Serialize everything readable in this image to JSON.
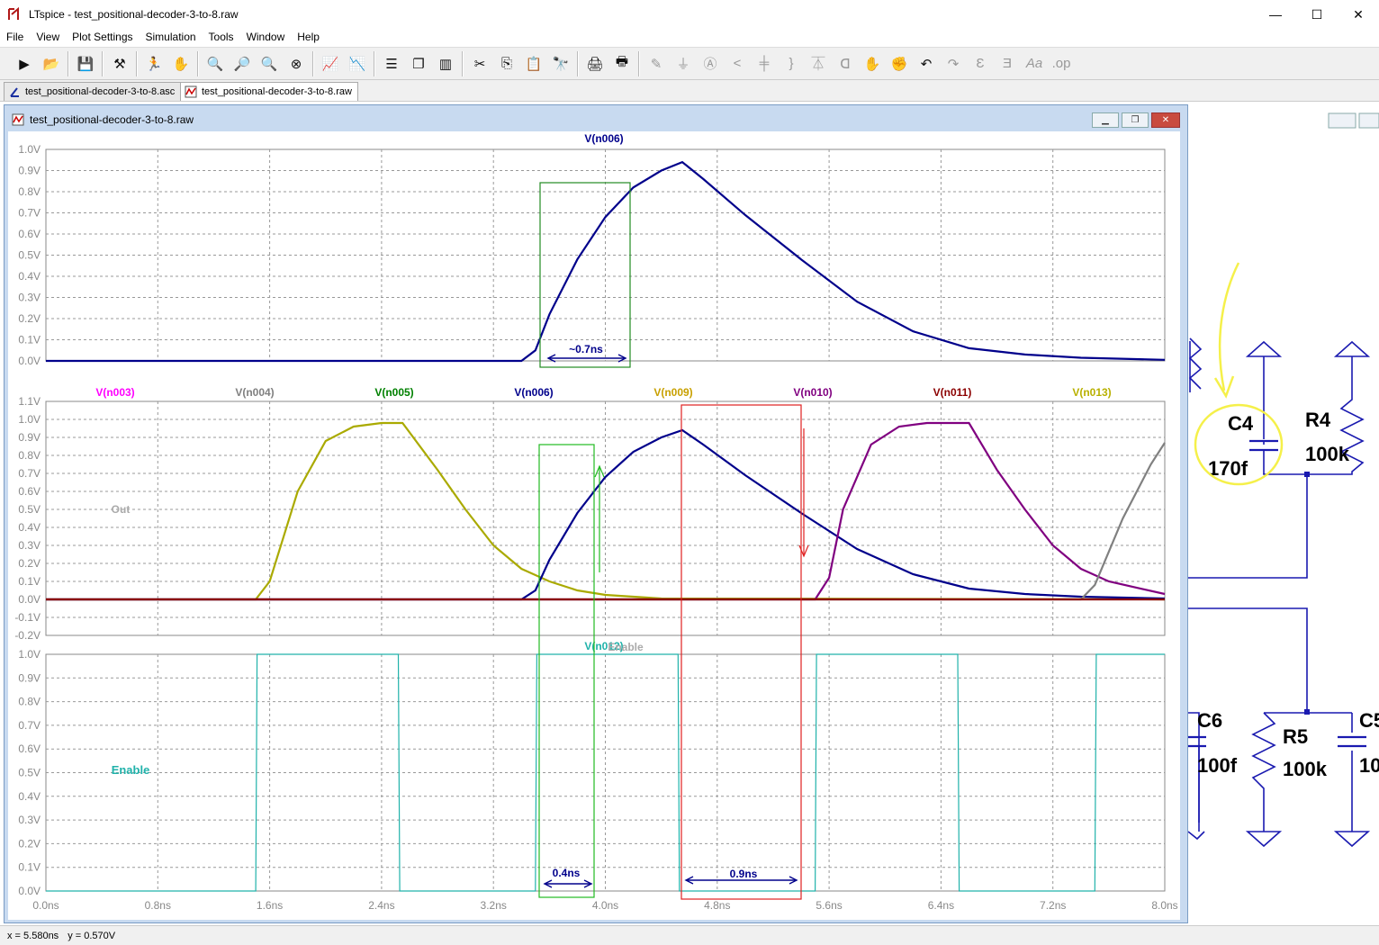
{
  "window": {
    "title": "LTspice - test_positional-decoder-3-to-8.raw",
    "minimize": "—",
    "maximize": "☐",
    "close": "✕"
  },
  "menu": [
    "File",
    "View",
    "Plot Settings",
    "Simulation",
    "Tools",
    "Window",
    "Help"
  ],
  "toolbar": {
    "icons": [
      "run-icon",
      "open-icon",
      "save-icon",
      "control-panel-icon",
      "halt-icon",
      "pan-icon",
      "zoom-in-icon",
      "zoom-area-icon",
      "zoom-out-icon",
      "zoom-fit-icon",
      "autorange-icon",
      "manual-limits-icon",
      "tile-horizontal-icon",
      "cascade-icon",
      "tile-vertical-icon",
      "cut-icon",
      "copy-icon",
      "paste-icon",
      "find-icon",
      "print-icon",
      "print-preview-icon",
      "wire-icon",
      "ground-icon",
      "label-icon",
      "resistor-icon",
      "capacitor-icon",
      "inductor-icon",
      "diode-icon",
      "component-icon",
      "move-icon",
      "drag-icon",
      "undo-icon",
      "redo-icon",
      "rotate-icon",
      "mirror-icon",
      "text-icon",
      "spice-directive-icon"
    ]
  },
  "tabs": [
    {
      "label": "test_positional-decoder-3-to-8.asc",
      "active": false
    },
    {
      "label": "test_positional-decoder-3-to-8.raw",
      "active": true
    }
  ],
  "plot_window": {
    "title": "test_positional-decoder-3-to-8.raw"
  },
  "statusbar": {
    "x": "x = 5.580ns",
    "y": "y = 0.570V"
  },
  "chart_data": [
    {
      "type": "line",
      "pane": "top",
      "series": [
        {
          "name": "V(n006)",
          "color": "#00008b",
          "x": [
            0,
            3.3,
            3.4,
            3.5,
            3.6,
            3.8,
            4.0,
            4.2,
            4.4,
            4.55,
            4.7,
            5.0,
            5.4,
            5.8,
            6.2,
            6.6,
            7.0,
            7.4,
            8.0
          ],
          "y": [
            0,
            0,
            0,
            0.05,
            0.22,
            0.48,
            0.68,
            0.82,
            0.9,
            0.94,
            0.86,
            0.69,
            0.48,
            0.28,
            0.14,
            0.06,
            0.03,
            0.015,
            0.005
          ]
        }
      ],
      "ylim": [
        0,
        1.0
      ],
      "yticks": [
        "1.0V",
        "0.9V",
        "0.8V",
        "0.7V",
        "0.6V",
        "0.5V",
        "0.4V",
        "0.3V",
        "0.2V",
        "0.1V",
        "0.0V"
      ],
      "annotations": [
        "~0.7ns"
      ]
    },
    {
      "type": "line",
      "pane": "middle",
      "legend": [
        "V(n003)",
        "V(n004)",
        "V(n005)",
        "V(n006)",
        "V(n009)",
        "V(n010)",
        "V(n011)",
        "V(n013)"
      ],
      "legend_colors": [
        "#ff00ff",
        "#808080",
        "#008000",
        "#00008b",
        "#c8a000",
        "#800080",
        "#8b0000",
        "#b8b000"
      ],
      "series": [
        {
          "name": "V(n005)",
          "color": "#aaaa00",
          "x": [
            0,
            1.5,
            1.6,
            1.8,
            2.0,
            2.2,
            2.4,
            2.55,
            2.8,
            3.0,
            3.2,
            3.4,
            3.6,
            3.8,
            4.0,
            4.4,
            8.0
          ],
          "y": [
            0,
            0,
            0.1,
            0.6,
            0.88,
            0.96,
            0.98,
            0.98,
            0.72,
            0.5,
            0.3,
            0.17,
            0.1,
            0.05,
            0.025,
            0.005,
            0
          ]
        },
        {
          "name": "V(n006)",
          "color": "#00008b",
          "x": [
            0,
            3.3,
            3.4,
            3.5,
            3.6,
            3.8,
            4.0,
            4.2,
            4.4,
            4.55,
            4.7,
            5.0,
            5.4,
            5.8,
            6.2,
            6.6,
            7.0,
            7.4,
            8.0
          ],
          "y": [
            0,
            0,
            0,
            0.05,
            0.22,
            0.48,
            0.68,
            0.82,
            0.9,
            0.94,
            0.86,
            0.69,
            0.48,
            0.28,
            0.14,
            0.06,
            0.03,
            0.015,
            0.005
          ]
        },
        {
          "name": "V(n011)",
          "color": "#800080",
          "x": [
            0,
            5.5,
            5.6,
            5.7,
            5.9,
            6.1,
            6.3,
            6.5,
            6.6,
            6.8,
            7.0,
            7.2,
            7.4,
            7.6,
            8.0
          ],
          "y": [
            0,
            0,
            0.12,
            0.5,
            0.86,
            0.96,
            0.98,
            0.98,
            0.98,
            0.72,
            0.5,
            0.3,
            0.17,
            0.1,
            0.03
          ]
        },
        {
          "name": "V(n013)",
          "color": "#808080",
          "x": [
            0,
            7.4,
            7.5,
            7.7,
            7.9,
            8.0
          ],
          "y": [
            0,
            0,
            0.08,
            0.45,
            0.75,
            0.87
          ]
        },
        {
          "name": "V(n004)",
          "color": "#8b0000",
          "x": [
            0,
            8.0
          ],
          "y": [
            0,
            0
          ]
        }
      ],
      "ylim": [
        -0.2,
        1.1
      ],
      "yticks": [
        "1.1V",
        "1.0V",
        "0.9V",
        "0.8V",
        "0.7V",
        "0.6V",
        "0.5V",
        "0.4V",
        "0.3V",
        "0.2V",
        "0.1V",
        "0.0V",
        "-0.1V",
        "-0.2V"
      ],
      "annotations": [
        "Out"
      ]
    },
    {
      "type": "line",
      "pane": "bottom",
      "series": [
        {
          "name": "V(n012)",
          "color": "#20b2aa",
          "x": [
            0,
            1.5,
            1.51,
            2.52,
            2.53,
            3.5,
            3.51,
            4.52,
            4.53,
            5.5,
            5.51,
            6.52,
            6.53,
            7.5,
            7.51,
            8.0
          ],
          "y": [
            0,
            0,
            1.0,
            1.0,
            0,
            0,
            1.0,
            1.0,
            0,
            0,
            1.0,
            1.0,
            0,
            0,
            1.0,
            1.0
          ]
        }
      ],
      "ylim": [
        0,
        1.0
      ],
      "yticks": [
        "1.0V",
        "0.9V",
        "0.8V",
        "0.7V",
        "0.6V",
        "0.5V",
        "0.4V",
        "0.3V",
        "0.2V",
        "0.1V",
        "0.0V"
      ],
      "annotations": [
        "Enable",
        "Enable",
        "0.4ns",
        "0.9ns"
      ],
      "xticks": [
        "0.0ns",
        "0.8ns",
        "1.6ns",
        "2.4ns",
        "3.2ns",
        "4.0ns",
        "4.8ns",
        "5.6ns",
        "6.4ns",
        "7.2ns",
        "8.0ns"
      ],
      "xlim": [
        0,
        8.0
      ]
    }
  ],
  "schematic": {
    "components": [
      {
        "ref": "C4",
        "value": "170f"
      },
      {
        "ref": "R4",
        "value": "100k"
      },
      {
        "ref": "C6",
        "value": "100f"
      },
      {
        "ref": "R5",
        "value": "100k"
      },
      {
        "ref": "C5",
        "value": "10"
      }
    ],
    "c5_ref_visible": "C5"
  }
}
